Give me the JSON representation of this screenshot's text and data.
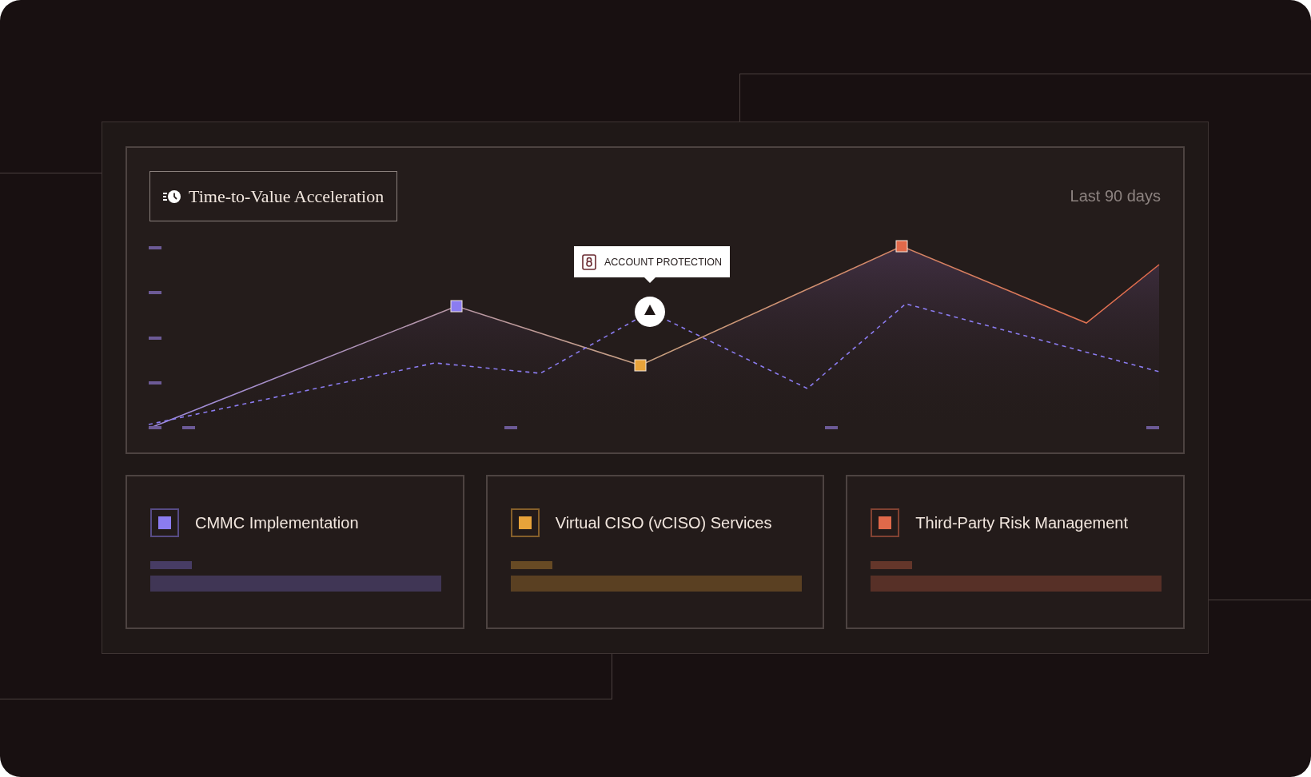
{
  "chart_panel": {
    "title": "Time-to-Value Acceleration",
    "period": "Last 90 days",
    "tooltip": {
      "label": "ACCOUNT PROTECTION"
    }
  },
  "legend": [
    {
      "name": "CMMC Implementation",
      "color": "#8b7cf0"
    },
    {
      "name": "Virtual CISO (vCISO) Services",
      "color": "#e8a33a"
    },
    {
      "name": "Third-Party Risk Management",
      "color": "#e0694a"
    }
  ]
}
